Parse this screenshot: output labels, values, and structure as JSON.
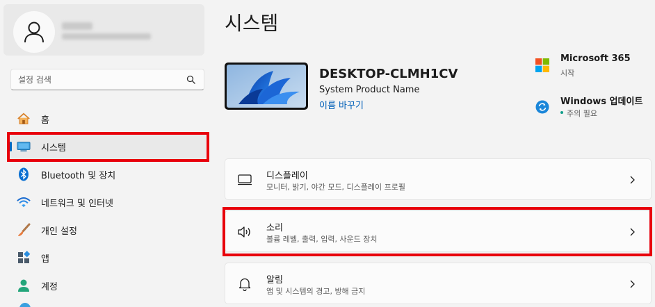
{
  "sidebar": {
    "search_placeholder": "설정 검색",
    "items": [
      {
        "label": "홈",
        "icon": "home-icon"
      },
      {
        "label": "시스템",
        "icon": "system-icon",
        "selected": true
      },
      {
        "label": "Bluetooth 및 장치",
        "icon": "bluetooth-icon"
      },
      {
        "label": "네트워크 및 인터넷",
        "icon": "network-icon"
      },
      {
        "label": "개인 설정",
        "icon": "brush-icon"
      },
      {
        "label": "앱",
        "icon": "apps-icon"
      },
      {
        "label": "계정",
        "icon": "account-icon"
      }
    ]
  },
  "main": {
    "title": "시스템",
    "device": {
      "name": "DESKTOP-CLMH1CV",
      "model": "System Product Name",
      "rename": "이름 바꾸기"
    },
    "side_cards": [
      {
        "title": "Microsoft 365",
        "subtitle": "시작",
        "icon": "microsoft-logo-icon"
      },
      {
        "title": "Windows 업데이트",
        "subtitle": "주의 필요",
        "icon": "windows-update-icon"
      }
    ],
    "settings": [
      {
        "title": "디스플레이",
        "description": "모니터, 밝기, 야간 모드, 디스플레이 프로필",
        "icon": "display-icon"
      },
      {
        "title": "소리",
        "description": "볼륨 레벨, 출력, 입력, 사운드 장치",
        "icon": "speaker-icon"
      },
      {
        "title": "알림",
        "description": "앱 및 시스템의 경고, 방해 금지",
        "icon": "bell-icon"
      }
    ]
  },
  "colors": {
    "accent": "#0067c0",
    "link": "#005fb8",
    "highlight": "#e8000b",
    "update_dot": "#0f9d8a"
  }
}
